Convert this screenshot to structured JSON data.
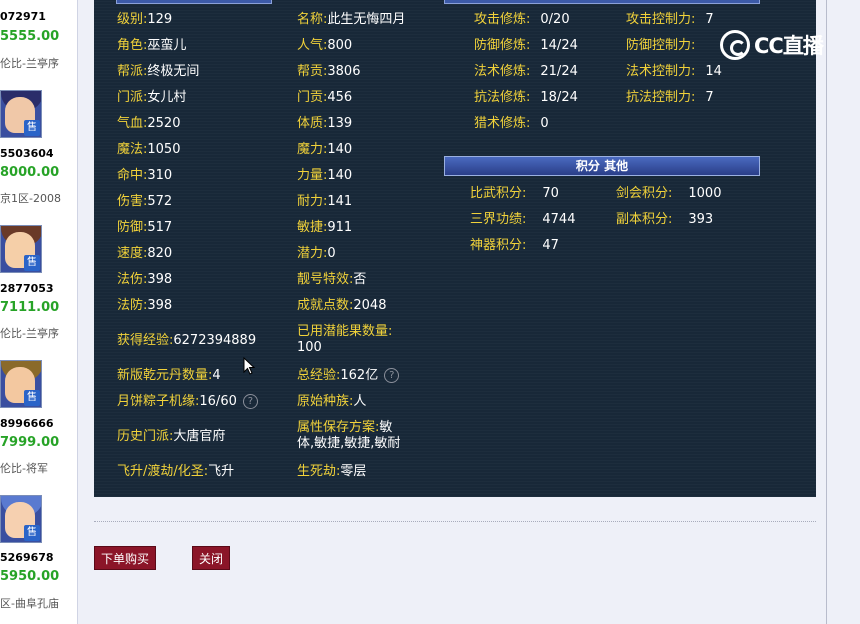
{
  "listing": [
    {
      "id": "072971",
      "price": "5555.00",
      "server": "伦比-兰亭序"
    },
    {
      "id": "5503604",
      "price": "8000.00",
      "server": "京1区-2008"
    },
    {
      "id": "2877053",
      "price": "7111.00",
      "server": "伦比-兰亭序"
    },
    {
      "id": "8996666",
      "price": "7999.00",
      "server": "伦比-将军"
    },
    {
      "id": "5269678",
      "price": "5950.00",
      "server": "区-曲阜孔庙"
    }
  ],
  "badge_label": "售",
  "stats_left": {
    "level": {
      "label": "级别:",
      "value": "129"
    },
    "role": {
      "label": "角色:",
      "value": "巫蛮儿"
    },
    "guild": {
      "label": "帮派:",
      "value": "终极无间"
    },
    "school": {
      "label": "门派:",
      "value": "女儿村"
    },
    "hp": {
      "label": "气血:",
      "value": "2520"
    },
    "mp": {
      "label": "魔法:",
      "value": "1050"
    },
    "hit": {
      "label": "命中:",
      "value": "310"
    },
    "damage": {
      "label": "伤害:",
      "value": "572"
    },
    "defense": {
      "label": "防御:",
      "value": "517"
    },
    "speed": {
      "label": "速度:",
      "value": "820"
    },
    "mag_dmg": {
      "label": "法伤:",
      "value": "398"
    },
    "mag_def": {
      "label": "法防:",
      "value": "398"
    },
    "exp": {
      "label": "获得经验:",
      "value": "6272394889"
    },
    "qianyuan": {
      "label": "新版乾元丹数量:",
      "value": "4"
    },
    "zongzi": {
      "label": "月饼粽子机缘:",
      "value": "16/60"
    },
    "history_school": {
      "label": "历史门派:",
      "value": "大唐官府"
    },
    "ascend": {
      "label": "飞升/渡劫/化圣:",
      "value": "飞升"
    }
  },
  "stats_mid": {
    "name": {
      "label": "名称:",
      "value": "此生无悔四月"
    },
    "popularity": {
      "label": "人气:",
      "value": "800"
    },
    "guild_contrib": {
      "label": "帮贡:",
      "value": "3806"
    },
    "school_contrib": {
      "label": "门贡:",
      "value": "456"
    },
    "constitution": {
      "label": "体质:",
      "value": "139"
    },
    "magic": {
      "label": "魔力:",
      "value": "140"
    },
    "strength": {
      "label": "力量:",
      "value": "140"
    },
    "endurance": {
      "label": "耐力:",
      "value": "141"
    },
    "agility": {
      "label": "敏捷:",
      "value": "911"
    },
    "potential": {
      "label": "潜力:",
      "value": "0"
    },
    "pretty_id": {
      "label": "靓号特效:",
      "value": "否"
    },
    "achievement": {
      "label": "成就点数:",
      "value": "2048"
    },
    "used_potential_fruit": {
      "label": "已用潜能果数量:",
      "value": "100"
    },
    "total_exp": {
      "label": "总经验:",
      "value": "162亿"
    },
    "origin_race": {
      "label": "原始种族:",
      "value": "人"
    },
    "attr_scheme": {
      "label": "属性保存方案:",
      "value": "敏",
      "value2": "体,敏捷,敏捷,敏耐"
    },
    "life_death": {
      "label": "生死劫:",
      "value": "零层"
    }
  },
  "cultivation": {
    "atk": {
      "label": "攻击修炼:",
      "value": "0/20"
    },
    "def": {
      "label": "防御修炼:",
      "value": "14/24"
    },
    "mag": {
      "label": "法术修炼:",
      "value": "21/24"
    },
    "resist": {
      "label": "抗法修炼:",
      "value": "18/24"
    },
    "hunt": {
      "label": "猎术修炼:",
      "value": "0"
    },
    "atk_ctrl": {
      "label": "攻击控制力:",
      "value": "7"
    },
    "def_ctrl": {
      "label": "防御控制力:",
      "value": ""
    },
    "mag_ctrl": {
      "label": "法术控制力:",
      "value": "14"
    },
    "resist_ctrl": {
      "label": "抗法控制力:",
      "value": "7"
    }
  },
  "points_section": {
    "title": "积分 其他",
    "pk": {
      "label": "比武积分:",
      "value": "70"
    },
    "sword": {
      "label": "剑会积分:",
      "value": "1000"
    },
    "merit": {
      "label": "三界功绩:",
      "value": "4744"
    },
    "dungeon": {
      "label": "副本积分:",
      "value": "393"
    },
    "artifact": {
      "label": "神器积分:",
      "value": "47"
    }
  },
  "logo_text": "CC直播",
  "buttons": {
    "buy": "下单购买",
    "close": "关闭"
  },
  "help_glyph": "?",
  "colors": {
    "label": "#f1d23a",
    "value": "#ffffff",
    "price": "#27a327",
    "button": "#8b1528",
    "panel": "#182838"
  }
}
